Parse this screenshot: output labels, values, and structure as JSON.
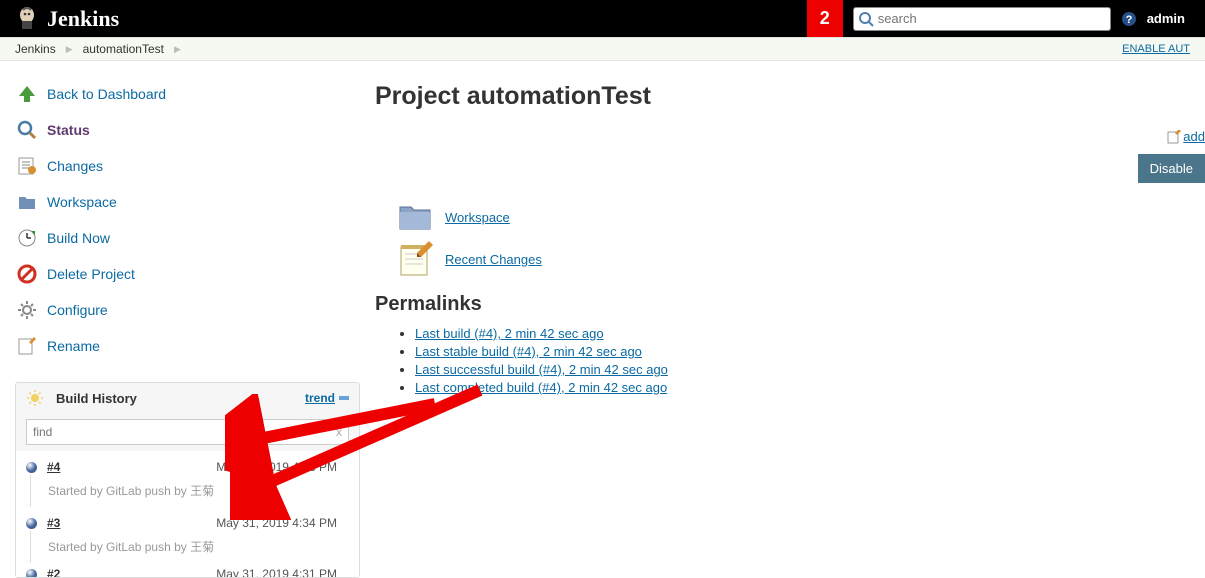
{
  "header": {
    "brand": "Jenkins",
    "alert_count": "2",
    "search_placeholder": "search",
    "user": "admin"
  },
  "breadcrumbs": {
    "items": [
      "Jenkins",
      "automationTest"
    ],
    "right_link": "ENABLE AUT"
  },
  "sidebar": {
    "nav": [
      {
        "label": "Back to Dashboard",
        "icon": "up-arrow-icon",
        "active": false
      },
      {
        "label": "Status",
        "icon": "search-icon",
        "active": true
      },
      {
        "label": "Changes",
        "icon": "changes-icon",
        "active": false
      },
      {
        "label": "Workspace",
        "icon": "folder-icon",
        "active": false
      },
      {
        "label": "Build Now",
        "icon": "clock-icon",
        "active": false
      },
      {
        "label": "Delete Project",
        "icon": "delete-icon",
        "active": false
      },
      {
        "label": "Configure",
        "icon": "gear-icon",
        "active": false
      },
      {
        "label": "Rename",
        "icon": "rename-icon",
        "active": false
      }
    ],
    "build_history": {
      "title": "Build History",
      "trend": "trend",
      "filter_placeholder": "find",
      "builds": [
        {
          "num": "#4",
          "date": "May 31, 2019 4:38 PM",
          "cause": "Started by GitLab push by 王菊"
        },
        {
          "num": "#3",
          "date": "May 31, 2019 4:34 PM",
          "cause": "Started by GitLab push by 王菊"
        },
        {
          "num": "#2",
          "date": "May 31, 2019 4:31 PM",
          "cause": ""
        }
      ]
    }
  },
  "main": {
    "title": "Project automationTest",
    "add_description": "add ",
    "disable_button": "Disable ",
    "links": [
      {
        "label": "Workspace"
      },
      {
        "label": "Recent Changes"
      }
    ],
    "permalinks_title": "Permalinks",
    "permalinks": [
      "Last build (#4), 2 min 42 sec ago",
      "Last stable build (#4), 2 min 42 sec ago",
      "Last successful build (#4), 2 min 42 sec ago",
      "Last completed build (#4), 2 min 42 sec ago"
    ]
  }
}
